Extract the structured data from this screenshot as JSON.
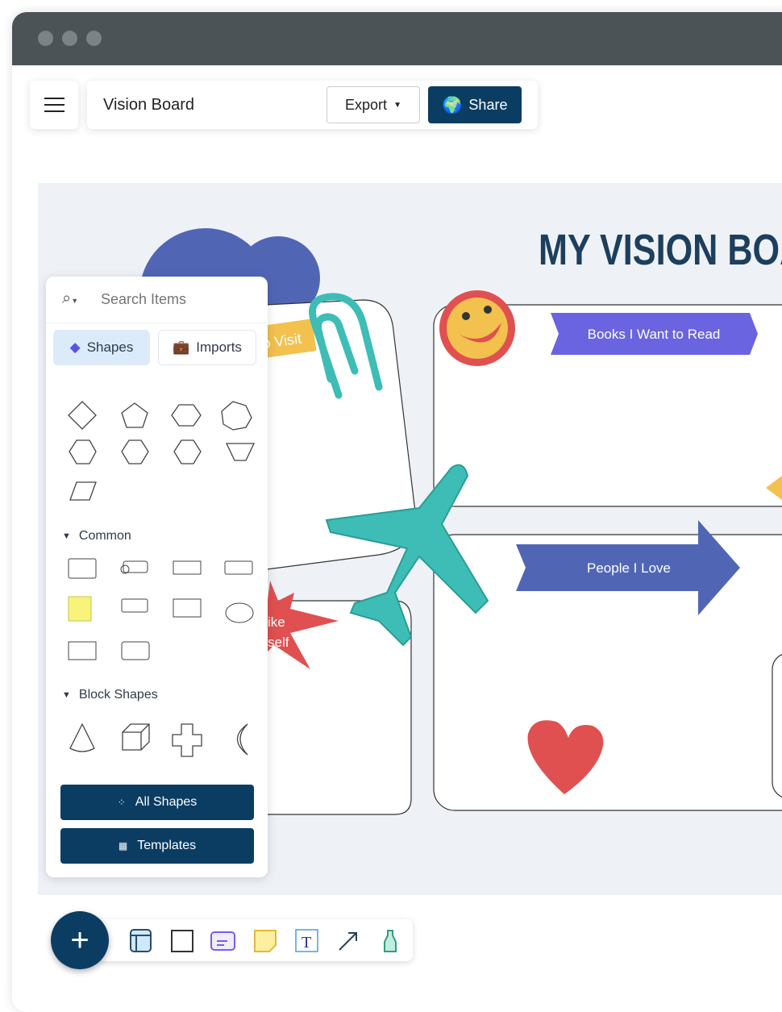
{
  "header": {
    "board_title": "Vision Board",
    "export_label": "Export",
    "share_label": "Share"
  },
  "board": {
    "title": "MY VISION BOA",
    "labels": {
      "places": "o Visit",
      "books": "Books I Want to Read",
      "people": "People I Love",
      "like_line1": "ike",
      "like_line2": "self"
    }
  },
  "panel": {
    "search_placeholder": "Search Items",
    "tabs": [
      {
        "label": "Shapes",
        "icon": "diamond-icon",
        "active": true
      },
      {
        "label": "Imports",
        "icon": "briefcase-icon",
        "active": false
      }
    ],
    "sections": [
      {
        "label": "Common"
      },
      {
        "label": "Block Shapes"
      }
    ],
    "all_shapes_label": "All Shapes",
    "templates_label": "Templates"
  },
  "toolbar": {
    "tools": [
      "frame-icon",
      "rectangle-icon",
      "card-icon",
      "sticky-note-icon",
      "text-icon",
      "arrow-icon",
      "marker-icon"
    ]
  },
  "colors": {
    "primary": "#0b3d63",
    "canvas": "#eef2f7",
    "teal": "#3dbdb5",
    "purple": "#6a64e0",
    "blue": "#5066b5",
    "red": "#e05050",
    "yellow": "#f2c14e"
  }
}
